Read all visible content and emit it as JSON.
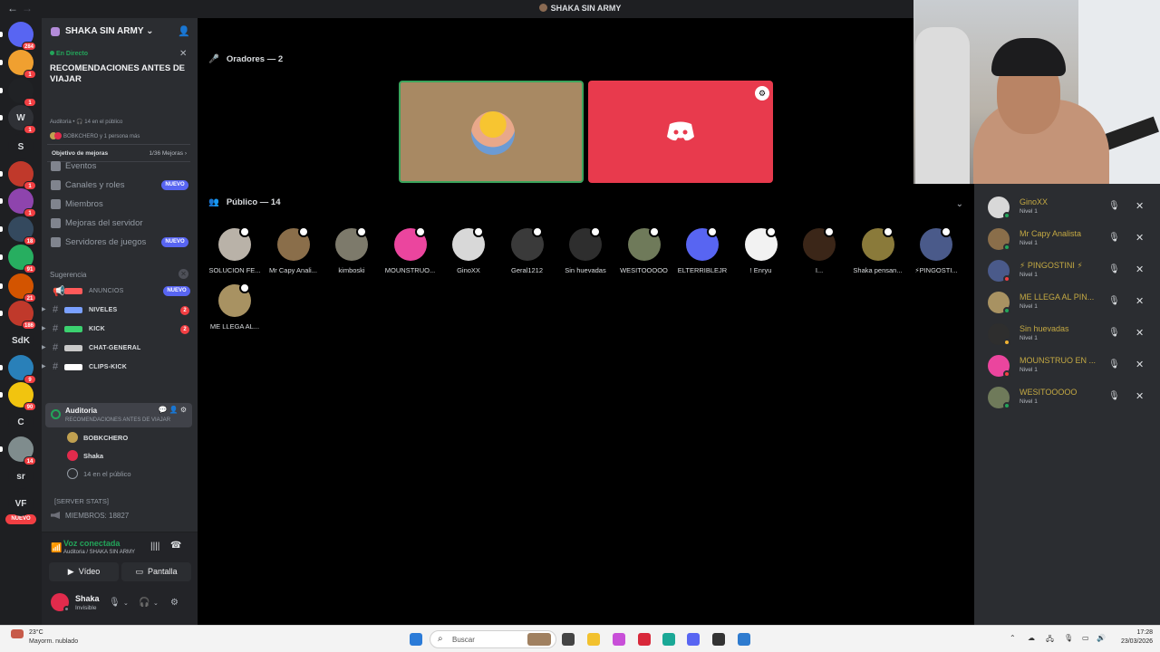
{
  "window": {
    "title": "SHAKA SIN ARMY",
    "back_icon": "arrow-left-icon",
    "forward_icon": "arrow-right-icon"
  },
  "rail": {
    "servers": [
      {
        "label": "",
        "color": "#5865f2",
        "badge": "284"
      },
      {
        "label": "",
        "color": "#f0a030",
        "badge": "1"
      },
      {
        "label": "",
        "color": "#202225",
        "badge": "1"
      },
      {
        "label": "W",
        "color": "#2f3136",
        "badge": "1"
      },
      {
        "label": "S",
        "color": "#1e1f22",
        "badge": ""
      },
      {
        "label": "",
        "color": "#c0392b",
        "badge": "1"
      },
      {
        "label": "",
        "color": "#8e44ad",
        "badge": "1"
      },
      {
        "label": "",
        "color": "#34495e",
        "badge": "18"
      },
      {
        "label": "",
        "color": "#27ae60",
        "badge": "91"
      },
      {
        "label": "",
        "color": "#d35400",
        "badge": "21"
      },
      {
        "label": "",
        "color": "#c0392b",
        "badge": "186"
      },
      {
        "label": "SdK",
        "color": "#1e1f22",
        "badge": ""
      },
      {
        "label": "",
        "color": "#2980b9",
        "badge": "9"
      },
      {
        "label": "",
        "color": "#f1c40f",
        "badge": "90"
      },
      {
        "label": "C",
        "color": "#1e1f22",
        "badge": ""
      },
      {
        "label": "",
        "color": "#7f8c8d",
        "badge": "14"
      },
      {
        "label": "sr",
        "color": "#1e1f22",
        "badge": ""
      },
      {
        "label": "VF",
        "color": "#1e1f22",
        "badge": ""
      }
    ],
    "new_label": "NUEVO"
  },
  "sidebar": {
    "server_name": "SHAKA SIN ARMY",
    "live_label": "En Directo",
    "stage_topic": "RECOMENDACIONES ANTES DE VIAJAR",
    "stage_meta": "Auditoria • 🎧 14 en el público",
    "stage_meta2": "BOBKCHERO y 1 persona más",
    "goal_label": "Objetivo de mejoras",
    "goal_value": "1/36 Mejoras",
    "nav": [
      {
        "label": "Eventos",
        "new": ""
      },
      {
        "label": "Canales y roles",
        "new": "NUEVO"
      },
      {
        "label": "Miembros",
        "new": ""
      },
      {
        "label": "Mejoras del servidor",
        "new": ""
      },
      {
        "label": "Servidores de juegos",
        "new": "NUEVO"
      }
    ],
    "suggestion_label": "Sugerencia",
    "channels": [
      {
        "name": "ANUNCIOS",
        "count": "",
        "new": "NUEVO",
        "dim": true
      },
      {
        "name": "NIVELES",
        "count": "2",
        "new": "",
        "dim": false
      },
      {
        "name": "KICK",
        "count": "2",
        "new": "",
        "dim": false
      },
      {
        "name": "CHAT-GENERAL",
        "count": "",
        "new": "",
        "dim": false
      },
      {
        "name": "CLIPS-KICK",
        "count": "",
        "new": "",
        "dim": false
      }
    ],
    "auditorium": {
      "name": "Auditoria",
      "subtitle": "RECOMENDACIONES ANTES DE VIAJAR"
    },
    "voice_users": [
      {
        "name": "BOBKCHERO",
        "color": "#c0a050"
      },
      {
        "name": "Shaka",
        "color": "#e12b4c"
      },
      {
        "name": "14 en el público",
        "color": ""
      }
    ],
    "server_stats": "[SERVER STATS]",
    "members_stat": "MIEMBROS: 18827"
  },
  "voice_panel": {
    "status": "Voz conectada",
    "location": "Auditoria / SHAKA SIN ARMY",
    "video_label": "Vídeo",
    "screen_label": "Pantalla",
    "user_name": "Shaka",
    "user_status": "Invisible"
  },
  "stage": {
    "speakers_header": "Oradores — 2",
    "audience_header": "Público — 14",
    "audience": [
      {
        "name": "SOLUCION FE...",
        "color": "#b9b2a8"
      },
      {
        "name": "Mr Capy Anali...",
        "color": "#8a6e4a"
      },
      {
        "name": "kimboski",
        "color": "#7d7a6b"
      },
      {
        "name": "MOUNSTRUO...",
        "color": "#eb459e"
      },
      {
        "name": "GinoXX",
        "color": "#d8d8d8"
      },
      {
        "name": "Geral1212",
        "color": "#3a3a3a"
      },
      {
        "name": "Sin huevadas",
        "color": "#2e2e2e"
      },
      {
        "name": "WESITOOOOO",
        "color": "#6f7a5a"
      },
      {
        "name": "ELTERRIBLEJR",
        "color": "#5865f2"
      },
      {
        "name": "! Enryu",
        "color": "#f2f2f2"
      },
      {
        "name": "I...",
        "color": "#3b2618"
      },
      {
        "name": "Shaka pensan...",
        "color": "#8a7a3a"
      },
      {
        "name": "⚡PINGOSTI...",
        "color": "#4a5a8a"
      },
      {
        "name": "ME LLEGA AL...",
        "color": "#a89262"
      }
    ]
  },
  "participants": [
    {
      "name": "GinoXX",
      "level": "Nivel 1",
      "color": "#d8d8d8",
      "status": "#23a55a"
    },
    {
      "name": "Mr Capy Analista",
      "level": "Nivel 1",
      "color": "#8a6e4a",
      "status": "#23a55a"
    },
    {
      "name": "⚡ PINGOSTINI ⚡",
      "level": "Nivel 1",
      "color": "#4a5a8a",
      "status": "#f23f43"
    },
    {
      "name": "ME LLEGA AL PIN...",
      "level": "Nivel 1",
      "color": "#a89262",
      "status": "#23a55a"
    },
    {
      "name": "Sin huevadas",
      "level": "Nivel 1",
      "color": "#2e2e2e",
      "status": "#f0b232"
    },
    {
      "name": "MOUNSTRUO EN ...",
      "level": "Nivel 1",
      "color": "#eb459e",
      "status": "#f23f43"
    },
    {
      "name": "WESITOOOOO",
      "level": "Nivel 1",
      "color": "#6f7a5a",
      "status": "#23a55a"
    }
  ],
  "taskbar": {
    "weather_temp": "23°C",
    "weather_desc": "Mayorm. nublado",
    "search_placeholder": "Buscar",
    "time": "17:28",
    "date": "23/03/2026"
  }
}
